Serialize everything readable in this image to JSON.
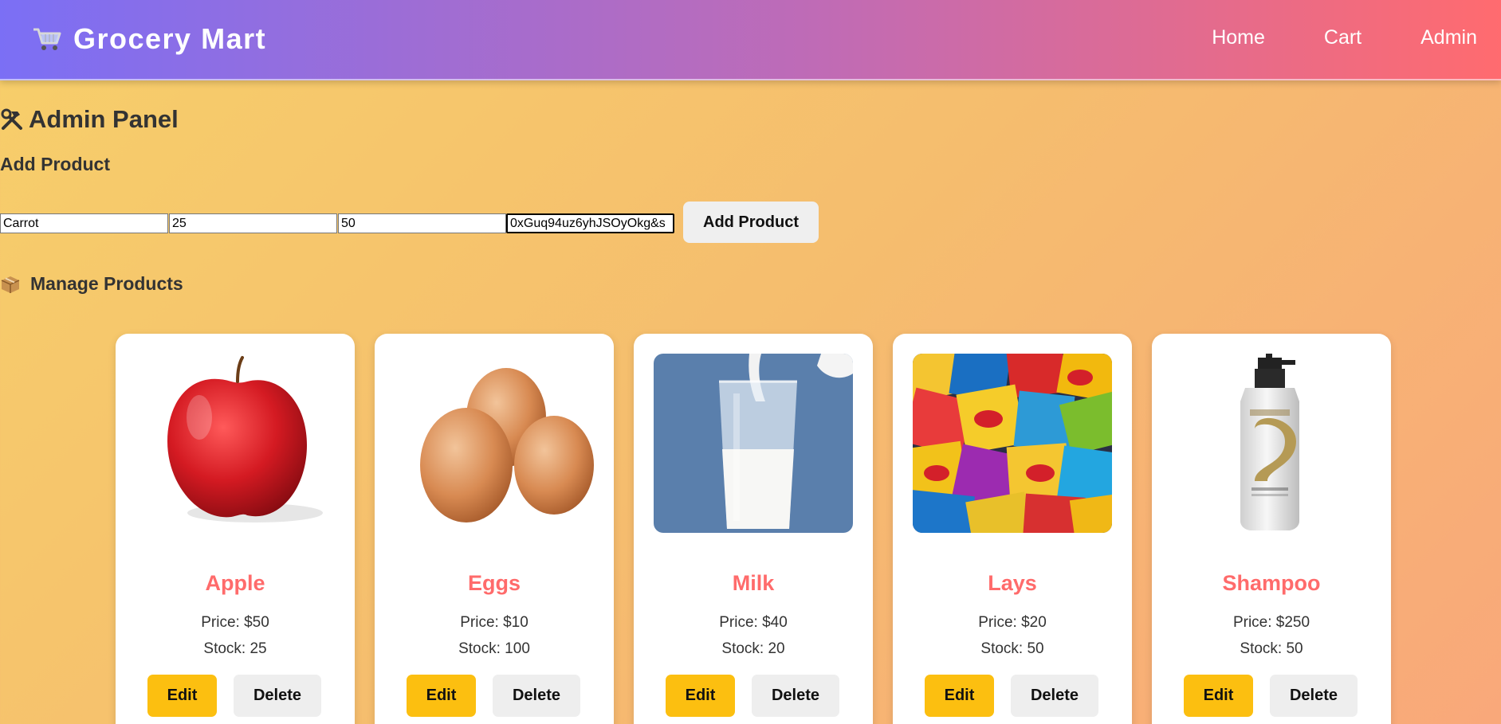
{
  "navbar": {
    "brand": "Grocery Mart",
    "brand_icon": "shopping-cart-icon",
    "links": [
      "Home",
      "Cart",
      "Admin"
    ],
    "gradient": [
      "#7b6ff5",
      "#ff6b6f"
    ]
  },
  "admin": {
    "title": "Admin Panel",
    "title_icon": "hammer-wrench-icon",
    "add_title": "Add Product",
    "manage_title": "Manage Products",
    "manage_icon": "package-icon"
  },
  "form": {
    "name_value": "Carrot",
    "price_value": "25",
    "stock_value": "50",
    "image_value": "0xGuq94uz6yhJSOyOkg&s",
    "submit_label": "Add Product"
  },
  "products": [
    {
      "name": "Apple",
      "price": "Price: $50",
      "stock": "Stock: 25",
      "image": "red-apple",
      "edit": "Edit",
      "delete": "Delete"
    },
    {
      "name": "Eggs",
      "price": "Price: $10",
      "stock": "Stock: 100",
      "image": "brown-eggs",
      "edit": "Edit",
      "delete": "Delete"
    },
    {
      "name": "Milk",
      "price": "Price: $40",
      "stock": "Stock: 20",
      "image": "glass-of-milk",
      "edit": "Edit",
      "delete": "Delete"
    },
    {
      "name": "Lays",
      "price": "Price: $20",
      "stock": "Stock: 50",
      "image": "chip-bags",
      "edit": "Edit",
      "delete": "Delete"
    },
    {
      "name": "Shampoo",
      "price": "Price: $250",
      "stock": "Stock: 50",
      "image": "shampoo-bottle",
      "edit": "Edit",
      "delete": "Delete"
    }
  ],
  "colors": {
    "product_name": "#ff6b6b",
    "edit_button": "#fcbf10",
    "delete_button": "#eeeeee"
  }
}
